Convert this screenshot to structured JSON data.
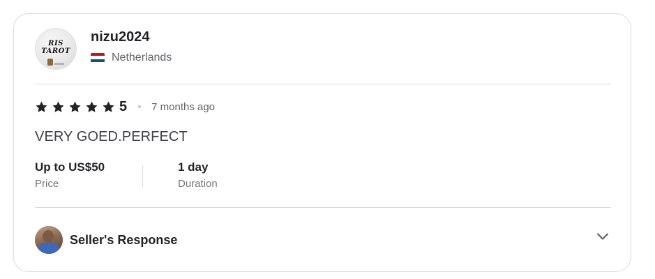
{
  "reviewer": {
    "avatar_logo_text": "RIS TAROT",
    "username": "nizu2024",
    "country": "Netherlands",
    "flag_icon": "netherlands-flag-icon"
  },
  "rating": {
    "stars": 5,
    "value": "5",
    "time_ago": "7 months ago"
  },
  "review": {
    "text": "VERY GOED.PERFECT"
  },
  "meta": {
    "price_value": "Up to US$50",
    "price_label": "Price",
    "duration_value": "1 day",
    "duration_label": "Duration"
  },
  "response": {
    "label": "Seller's Response",
    "toggle_icon": "chevron-down-icon"
  },
  "colors": {
    "text_primary": "#222325",
    "text_secondary": "#62646a",
    "border": "#dadbdd"
  }
}
